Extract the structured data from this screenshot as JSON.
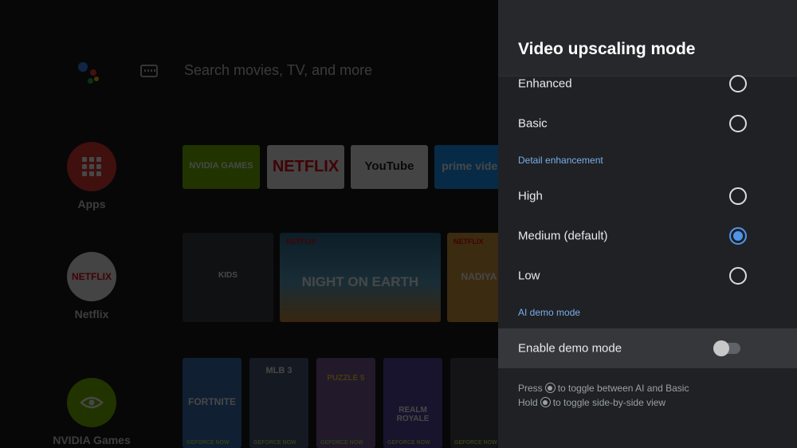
{
  "home": {
    "search_placeholder": "Search movies, TV, and more",
    "side": [
      {
        "label": "Apps"
      },
      {
        "label": "Netflix",
        "logo": "NETFLIX"
      },
      {
        "label": "NVIDIA Games"
      }
    ],
    "app_tiles": [
      {
        "name": "NVIDIA GAMES"
      },
      {
        "name": "NETFLIX"
      },
      {
        "name": "YouTube"
      },
      {
        "name": "prime video"
      }
    ],
    "row2": [
      {
        "title": "KIDS"
      },
      {
        "title": "NIGHT ON EARTH",
        "brand": "NETFLIX"
      },
      {
        "title": "NADIYA",
        "brand": "NETFLIX"
      }
    ],
    "games": [
      {
        "title": "FORTNITE",
        "badge": "GEFORCE NOW"
      },
      {
        "title": "MLB 3",
        "badge": "GEFORCE NOW"
      },
      {
        "title": "PUZZLE 5",
        "badge": "GEFORCE NOW"
      },
      {
        "title": "REALM ROYALE",
        "badge": "GEFORCE NOW"
      },
      {
        "title": "",
        "badge": "GEFORCE NOW"
      }
    ]
  },
  "panel": {
    "title": "Video upscaling mode",
    "modes": [
      {
        "label": "Enhanced",
        "selected": false
      },
      {
        "label": "Basic",
        "selected": false
      }
    ],
    "detail_section": "Detail enhancement",
    "detail_options": [
      {
        "label": "High",
        "selected": false
      },
      {
        "label": "Medium (default)",
        "selected": true
      },
      {
        "label": "Low",
        "selected": false
      }
    ],
    "demo_section": "AI demo mode",
    "demo_toggle": {
      "label": "Enable demo mode",
      "enabled": false
    },
    "hint_press": {
      "prefix": "Press",
      "suffix": "to toggle between AI and Basic"
    },
    "hint_hold": {
      "prefix": "Hold",
      "suffix": "to toggle side-by-side view"
    }
  },
  "colors": {
    "accent": "#4f95ea",
    "section": "#7aaeea",
    "panel_bg": "#1f2124",
    "netflix_red": "#e50914",
    "nvidia_green": "#76b900"
  }
}
